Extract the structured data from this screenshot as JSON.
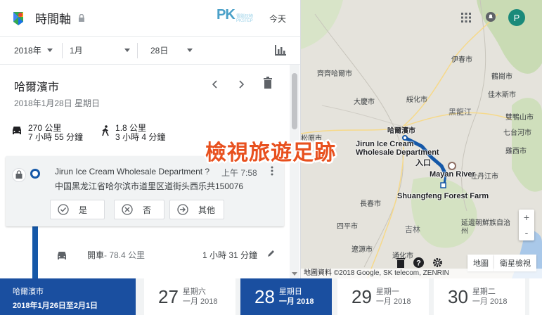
{
  "header": {
    "app_title": "時間軸",
    "watermark": "PK",
    "watermark_sub": "電腦玩物 PKSTEP",
    "today_label": "今天"
  },
  "date_selector": {
    "year": "2018年",
    "month": "1月",
    "day": "28日"
  },
  "day": {
    "city": "哈爾濱市",
    "date_line": "2018年1月28日 星期日"
  },
  "stats": {
    "drive_distance": "270 公里",
    "drive_duration": "7 小時 55 分鐘",
    "walk_distance": "1.8 公里",
    "walk_duration": "3 小時 4 分鐘"
  },
  "place_card": {
    "name": "Jirun Ice Cream Wholesale Department ?",
    "time": "上午 7:58",
    "address": "中国黑龙江省哈尔滨市道里区道街头西乐共150076",
    "yes_label": "是",
    "no_label": "否",
    "other_label": "其他"
  },
  "segment": {
    "mode": "開車",
    "distance": " - 78.4 公里",
    "duration": "1 小時 31 分鐘"
  },
  "map": {
    "labels": [
      "齊齊哈爾市",
      "伊春市",
      "大慶市",
      "綏化市",
      "黑龍江",
      "鶴崗市",
      "佳木斯市",
      "七台河市",
      "雙鴨山市",
      "雞西市",
      "牡丹江市",
      "松原市",
      "長春市",
      "四平市",
      "吉林",
      "延邊朝鮮族自治州",
      "通化市",
      "遼源市",
      "哈爾濱市"
    ],
    "pois": {
      "store": "Jirun Ice Cream Wholesale Department",
      "entrance": "入口",
      "river": "Mayan River",
      "forest": "Shuangfeng Forest Farm"
    },
    "overlay_title": "檢視旅遊足跡",
    "zoom_in": "+",
    "zoom_out": "-",
    "btn_map": "地圖",
    "btn_satellite": "衛星檢視",
    "attribution_label": "地圖資料",
    "attribution": " ©2018 Google, SK telecom, ZENRIN",
    "avatar_letter": "P",
    "route_color": "#1558a8"
  },
  "timeline_strip": {
    "range_city": "哈爾濱市",
    "range_dates": "2018年1月26日至2月1日",
    "days": [
      {
        "num": "27",
        "weekday": "星期六",
        "month_year": "一月 2018",
        "selected": false
      },
      {
        "num": "28",
        "weekday": "星期日",
        "month_year": "一月 2018",
        "selected": true
      },
      {
        "num": "29",
        "weekday": "星期一",
        "month_year": "一月 2018",
        "selected": false
      },
      {
        "num": "30",
        "weekday": "星期二",
        "month_year": "一月 2018",
        "selected": false
      }
    ]
  },
  "colors": {
    "accent_blue": "#1a4fa0",
    "overlay_orange": "#e8501e",
    "avatar_teal": "#1a8a7a"
  }
}
